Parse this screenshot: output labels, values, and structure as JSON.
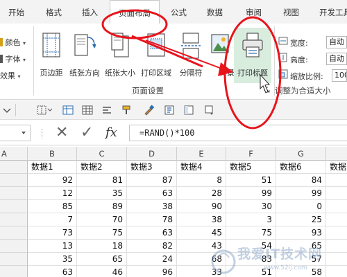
{
  "tabs": [
    {
      "label": "开始"
    },
    {
      "label": "格式"
    },
    {
      "label": "插入"
    },
    {
      "label": "页面布局"
    },
    {
      "label": "公式"
    },
    {
      "label": "数据"
    },
    {
      "label": "审阅"
    },
    {
      "label": "视图"
    },
    {
      "label": "开发工具"
    }
  ],
  "active_tab": "页面布局",
  "ribbon": {
    "theme_group": {
      "colors_label": "颜色",
      "fonts_label": "字体",
      "effects_label": "效果"
    },
    "page_setup": {
      "margins": "页边距",
      "orientation": "纸张方向",
      "size": "纸张大小",
      "print_area": "打印区域",
      "breaks": "分隔符",
      "background": "背景",
      "print_titles": "打印标题",
      "group_label": "页面设置"
    },
    "scale_to_fit": {
      "width_label": "宽度:",
      "width_value": "自动",
      "height_label": "高度:",
      "height_value": "自动",
      "scale_label": "缩放比例:",
      "scale_value": "100",
      "group_label": "调整为合适大小"
    }
  },
  "formula_bar": {
    "name_box": "",
    "cancel_symbol": "✕",
    "enter_symbol": "✓",
    "fx_label": "fx",
    "formula": "=RAND()*100"
  },
  "grid": {
    "columns": [
      "A",
      "B",
      "C",
      "D",
      "E",
      "F",
      "G"
    ],
    "header_row": [
      "",
      "数据1",
      "数据2",
      "数据3",
      "数据4",
      "数据5",
      "数据6",
      "数据"
    ],
    "rows": [
      [
        92,
        81,
        87,
        8,
        51,
        84
      ],
      [
        12,
        35,
        63,
        28,
        99,
        99
      ],
      [
        85,
        89,
        38,
        90,
        30,
        0
      ],
      [
        7,
        70,
        78,
        38,
        3,
        25
      ],
      [
        73,
        75,
        63,
        45,
        75,
        93
      ],
      [
        13,
        18,
        82,
        43,
        54,
        65
      ],
      [
        35,
        65,
        24,
        68,
        83,
        57
      ],
      [
        63,
        46,
        96,
        33,
        51,
        58
      ]
    ]
  },
  "watermark": {
    "text": "我爱IT技术网",
    "url": "www.52ij.com"
  },
  "annotation_color": "#e8141c",
  "accent_color": "#217346"
}
